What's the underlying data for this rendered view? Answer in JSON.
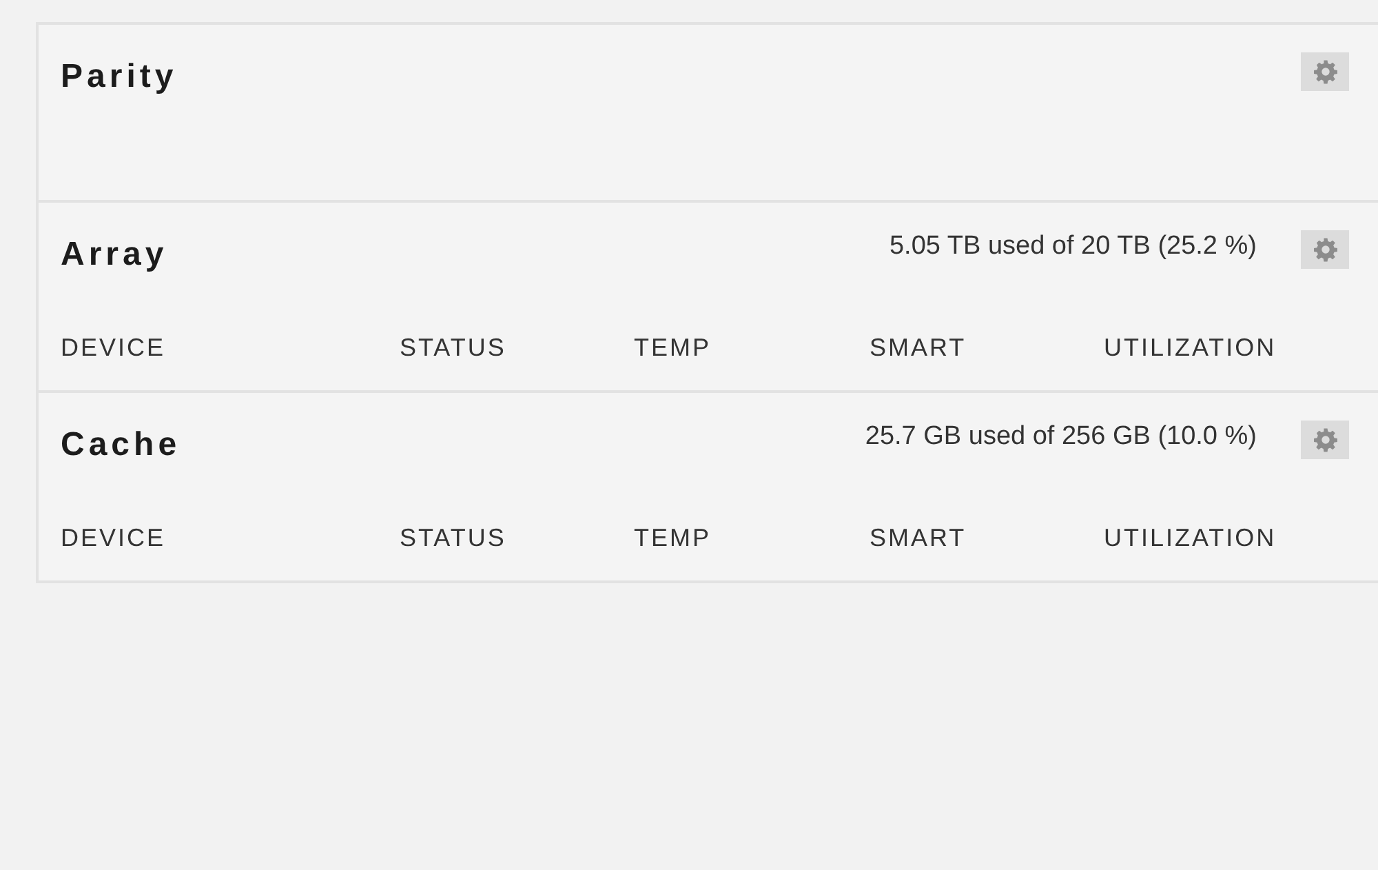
{
  "sections": [
    {
      "title": "Parity"
    },
    {
      "title": "Array",
      "usage": "5.05 TB used of 20 TB (25.2 %)",
      "columns": [
        "DEVICE",
        "STATUS",
        "TEMP",
        "SMART",
        "UTILIZATION"
      ]
    },
    {
      "title": "Cache",
      "usage": "25.7 GB used of 256 GB (10.0 %)",
      "columns": [
        "DEVICE",
        "STATUS",
        "TEMP",
        "SMART",
        "UTILIZATION"
      ]
    }
  ]
}
